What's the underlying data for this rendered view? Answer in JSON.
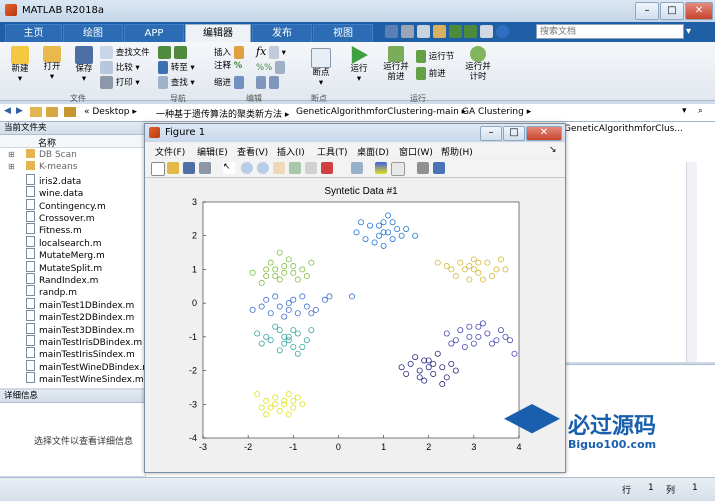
{
  "window": {
    "title": "MATLAB R2018a",
    "search_placeholder": "搜索文档"
  },
  "ribbon_tabs": [
    "主页",
    "绘图",
    "APP",
    "编辑器",
    "发布",
    "视图"
  ],
  "ribbon": {
    "file": {
      "new": "新建",
      "open": "打开",
      "save": "保存",
      "find_files": "查找文件",
      "compare": "比较",
      "print": "打印",
      "group": "文件"
    },
    "nav": {
      "goto": "转至",
      "find": "查找",
      "group": "导航"
    },
    "edit": {
      "insert": "插入",
      "comment": "注释",
      "indent": "缩进",
      "fx": "fx",
      "group": "编辑"
    },
    "breakpoint": {
      "label": "断点",
      "group": "断点"
    },
    "run": {
      "run": "运行",
      "run_advance": "运行并",
      "run_advance2": "前进",
      "run_section": "运行节",
      "advance": "前进",
      "run_time": "运行并",
      "run_time2": "计时",
      "group": "运行"
    }
  },
  "address": {
    "parts": [
      "Desktop",
      "一种基于遗传算法的聚类新方法",
      "GeneticAlgorithmforClustering-main",
      "GA Clustering"
    ]
  },
  "current_folder": {
    "title": "当前文件夹",
    "column": "名称",
    "files": [
      "DB Scan",
      "K-means",
      "iris2.data",
      "wine.data",
      "Contingency.m",
      "Crossover.m",
      "Fitness.m",
      "localsearch.m",
      "MutateMerg.m",
      "MutateSplit.m",
      "RandIndex.m",
      "randp.m",
      "mainTest1DBindex.m",
      "mainTest2DBindex.m",
      "mainTest3DBindex.m",
      "mainTestIrisDBindex.m",
      "mainTestIrisSindex.m",
      "mainTestWineDBindex.m",
      "mainTestWineSindex.m"
    ]
  },
  "details": {
    "title": "详细信息",
    "hint": "选择文件以查看详细信息"
  },
  "editor_tab_text": "GeneticAlgorithmforClus...",
  "figure": {
    "title": "Figure 1",
    "menu": [
      "文件(F)",
      "编辑(E)",
      "查看(V)",
      "插入(I)",
      "工具(T)",
      "桌面(D)",
      "窗口(W)",
      "帮助(H)"
    ]
  },
  "watermark": {
    "site": "Biguo100.com",
    "cn": "必过源码"
  },
  "status_bar": {
    "row_label": "行",
    "row": "1",
    "col_label": "列",
    "col": "1"
  },
  "chart_data": {
    "type": "scatter",
    "title": "Syntetic Data #1",
    "xlim": [
      -3,
      4
    ],
    "ylim": [
      -4,
      3
    ],
    "xticks": [
      -3,
      -2,
      -1,
      0,
      1,
      2,
      3,
      4
    ],
    "yticks": [
      -4,
      -3,
      -2,
      -1,
      0,
      1,
      2,
      3
    ],
    "grid": false,
    "series": [
      {
        "color": "#1f77d4",
        "values": [
          [
            0.4,
            2.1
          ],
          [
            0.7,
            2.3
          ],
          [
            0.9,
            2.0
          ],
          [
            1.0,
            2.4
          ],
          [
            1.1,
            2.1
          ],
          [
            1.2,
            1.9
          ],
          [
            1.3,
            2.2
          ],
          [
            0.8,
            1.8
          ],
          [
            1.1,
            2.6
          ],
          [
            0.6,
            1.9
          ],
          [
            1.4,
            2.0
          ],
          [
            1.0,
            1.7
          ],
          [
            0.9,
            2.3
          ],
          [
            1.2,
            2.4
          ],
          [
            1.5,
            2.2
          ],
          [
            0.5,
            2.4
          ],
          [
            1.7,
            2.0
          ],
          [
            1.0,
            2.1
          ]
        ]
      },
      {
        "color": "#7fbf3f",
        "values": [
          [
            -1.9,
            0.9
          ],
          [
            -1.6,
            1.0
          ],
          [
            -1.4,
            0.8
          ],
          [
            -1.2,
            1.1
          ],
          [
            -1.0,
            0.9
          ],
          [
            -0.8,
            1.0
          ],
          [
            -1.3,
            0.7
          ],
          [
            -1.5,
            1.2
          ],
          [
            -1.1,
            1.3
          ],
          [
            -0.9,
            0.7
          ],
          [
            -1.7,
            0.6
          ],
          [
            -0.6,
            1.2
          ],
          [
            -1.2,
            0.9
          ],
          [
            -1.4,
            1.0
          ],
          [
            -1.0,
            1.1
          ],
          [
            -1.6,
            0.8
          ],
          [
            -0.7,
            0.8
          ],
          [
            -1.3,
            1.5
          ]
        ]
      },
      {
        "color": "#d4b83a",
        "values": [
          [
            2.2,
            1.2
          ],
          [
            2.5,
            1.0
          ],
          [
            2.7,
            1.2
          ],
          [
            2.9,
            1.1
          ],
          [
            3.1,
            0.9
          ],
          [
            3.3,
            1.2
          ],
          [
            3.5,
            1.0
          ],
          [
            2.6,
            0.8
          ],
          [
            3.0,
            1.3
          ],
          [
            3.2,
            0.7
          ],
          [
            2.8,
            1.0
          ],
          [
            3.6,
            1.3
          ],
          [
            2.4,
            1.1
          ],
          [
            3.4,
            0.8
          ],
          [
            3.0,
            1.0
          ],
          [
            2.9,
            0.7
          ],
          [
            3.7,
            1.0
          ],
          [
            3.1,
            1.2
          ]
        ]
      },
      {
        "color": "#3e6fd0",
        "values": [
          [
            -1.9,
            -0.2
          ],
          [
            -1.6,
            0.1
          ],
          [
            -1.3,
            -0.1
          ],
          [
            -1.1,
            0.0
          ],
          [
            -0.9,
            -0.3
          ],
          [
            -0.7,
            -0.1
          ],
          [
            -1.2,
            -0.4
          ],
          [
            -1.5,
            -0.3
          ],
          [
            -0.8,
            0.2
          ],
          [
            -0.5,
            -0.2
          ],
          [
            -1.0,
            0.1
          ],
          [
            -1.4,
            0.2
          ],
          [
            -0.3,
            0.1
          ],
          [
            -1.7,
            -0.1
          ],
          [
            -0.6,
            -0.3
          ],
          [
            -1.1,
            -0.2
          ],
          [
            -0.2,
            0.2
          ],
          [
            0.3,
            0.2
          ]
        ]
      },
      {
        "color": "#3aa6a0",
        "values": [
          [
            -1.8,
            -0.9
          ],
          [
            -1.5,
            -1.1
          ],
          [
            -1.3,
            -0.8
          ],
          [
            -1.1,
            -1.0
          ],
          [
            -0.9,
            -0.9
          ],
          [
            -0.7,
            -1.1
          ],
          [
            -1.2,
            -1.2
          ],
          [
            -1.4,
            -0.7
          ],
          [
            -1.0,
            -0.8
          ],
          [
            -0.8,
            -1.3
          ],
          [
            -1.6,
            -1.0
          ],
          [
            -1.3,
            -1.4
          ],
          [
            -0.6,
            -0.8
          ],
          [
            -1.1,
            -1.1
          ],
          [
            -1.7,
            -1.2
          ],
          [
            -0.9,
            -1.5
          ],
          [
            -1.2,
            -1.0
          ],
          [
            -1.0,
            -1.3
          ]
        ]
      },
      {
        "color": "#4a4ab8",
        "values": [
          [
            2.4,
            -0.9
          ],
          [
            2.7,
            -0.8
          ],
          [
            2.9,
            -1.0
          ],
          [
            3.1,
            -0.7
          ],
          [
            3.3,
            -0.9
          ],
          [
            3.5,
            -1.1
          ],
          [
            3.0,
            -1.2
          ],
          [
            2.6,
            -1.1
          ],
          [
            3.2,
            -0.6
          ],
          [
            3.6,
            -0.8
          ],
          [
            2.8,
            -1.3
          ],
          [
            3.4,
            -1.2
          ],
          [
            3.7,
            -1.0
          ],
          [
            2.5,
            -1.2
          ],
          [
            3.9,
            -1.5
          ],
          [
            3.1,
            -1.0
          ],
          [
            2.9,
            -0.7
          ],
          [
            3.8,
            -1.1
          ]
        ]
      },
      {
        "color": "#2a2a80",
        "values": [
          [
            1.4,
            -1.9
          ],
          [
            1.6,
            -1.8
          ],
          [
            1.8,
            -2.0
          ],
          [
            2.0,
            -1.7
          ],
          [
            2.1,
            -2.1
          ],
          [
            2.3,
            -1.9
          ],
          [
            2.4,
            -2.2
          ],
          [
            1.9,
            -2.3
          ],
          [
            1.7,
            -1.6
          ],
          [
            2.2,
            -1.5
          ],
          [
            2.0,
            -1.9
          ],
          [
            1.5,
            -2.1
          ],
          [
            2.5,
            -1.8
          ],
          [
            2.3,
            -2.4
          ],
          [
            1.8,
            -2.2
          ],
          [
            2.1,
            -1.8
          ],
          [
            2.6,
            -2.0
          ],
          [
            1.9,
            -1.7
          ]
        ]
      },
      {
        "color": "#e0e020",
        "values": [
          [
            -1.8,
            -2.7
          ],
          [
            -1.6,
            -2.9
          ],
          [
            -1.4,
            -3.0
          ],
          [
            -1.2,
            -2.9
          ],
          [
            -1.0,
            -3.1
          ],
          [
            -0.9,
            -2.8
          ],
          [
            -1.3,
            -3.2
          ],
          [
            -1.5,
            -3.1
          ],
          [
            -1.1,
            -2.7
          ],
          [
            -0.8,
            -3.0
          ],
          [
            -1.7,
            -3.1
          ],
          [
            -1.2,
            -3.0
          ],
          [
            -1.4,
            -2.8
          ],
          [
            -1.0,
            -2.9
          ],
          [
            -1.6,
            -3.3
          ],
          [
            -1.1,
            -3.3
          ]
        ]
      }
    ]
  }
}
